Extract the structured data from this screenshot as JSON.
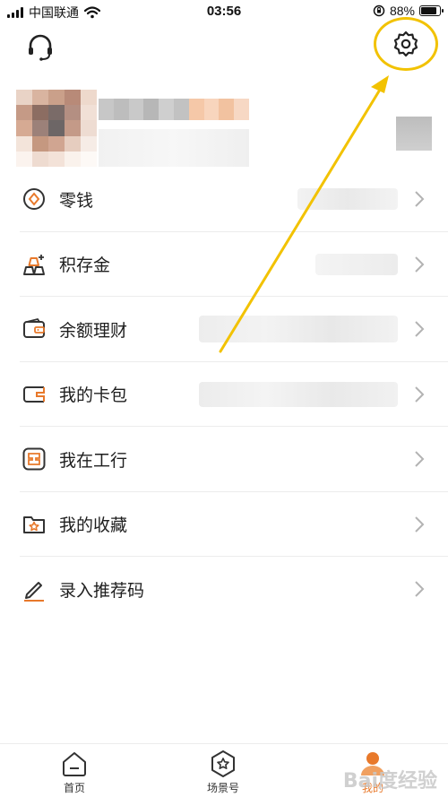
{
  "status_bar": {
    "carrier": "中国联通",
    "time": "03:56",
    "battery": "88%",
    "battery_level": 0.88
  },
  "header": {
    "left_icon": "headset-icon",
    "right_icon": "gear-icon"
  },
  "menu": [
    {
      "label": "零钱",
      "icon": "coin-icon"
    },
    {
      "label": "积存金",
      "icon": "gold-bars-icon"
    },
    {
      "label": "余额理财",
      "icon": "wallet-icon"
    },
    {
      "label": "我的卡包",
      "icon": "card-icon"
    },
    {
      "label": "我在工行",
      "icon": "icbc-logo-icon"
    },
    {
      "label": "我的收藏",
      "icon": "star-folder-icon"
    },
    {
      "label": "录入推荐码",
      "icon": "pen-icon"
    }
  ],
  "tabs": [
    {
      "label": "首页",
      "icon": "home-icon",
      "active": false
    },
    {
      "label": "场景号",
      "icon": "hexagon-star-icon",
      "active": false
    },
    {
      "label": "我的",
      "icon": "profile-icon",
      "active": true
    }
  ],
  "watermark": "Bai度经验",
  "colors": {
    "accent": "#e8792b",
    "annotation": "#f2c200",
    "chevron": "#b3b3b3"
  }
}
